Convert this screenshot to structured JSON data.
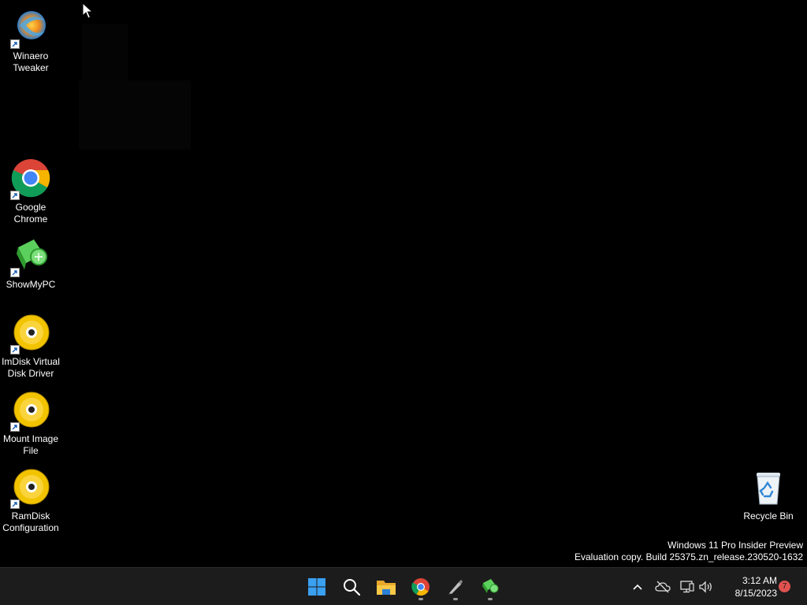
{
  "desktop": {
    "icons": [
      {
        "label_line1": "Winaero",
        "label_line2": "Tweaker",
        "icon": "winaero-tweaker-icon"
      },
      {
        "label_line1": "Google",
        "label_line2": "Chrome",
        "icon": "chrome-icon"
      },
      {
        "label_line1": "ShowMyPC",
        "label_line2": "",
        "icon": "showmypc-icon"
      },
      {
        "label_line1": "ImDisk Virtual",
        "label_line2": "Disk Driver",
        "icon": "disc-icon"
      },
      {
        "label_line1": "Mount Image",
        "label_line2": "File",
        "icon": "disc-icon"
      },
      {
        "label_line1": "RamDisk",
        "label_line2": "Configuration",
        "icon": "disc-icon"
      }
    ],
    "recycle_bin": {
      "label": "Recycle Bin",
      "icon": "recycle-bin-icon"
    }
  },
  "watermark": {
    "line1": "Windows 11 Pro Insider Preview",
    "line2": "Evaluation copy. Build 25375.zn_release.230520-1632"
  },
  "taskbar": {
    "pinned": [
      "start-icon",
      "search-icon",
      "file-explorer-icon",
      "chrome-icon",
      "pen-app-icon",
      "showmypc-icon"
    ],
    "tray": {
      "clock_time": "3:12 AM",
      "clock_date": "8/15/2023",
      "notification_count": "7"
    }
  },
  "colors": {
    "desktop_bg": "#000000",
    "taskbar_bg": "#1c1c1c",
    "start_blue": "#3aa0f0",
    "badge_red": "#e0524f"
  }
}
